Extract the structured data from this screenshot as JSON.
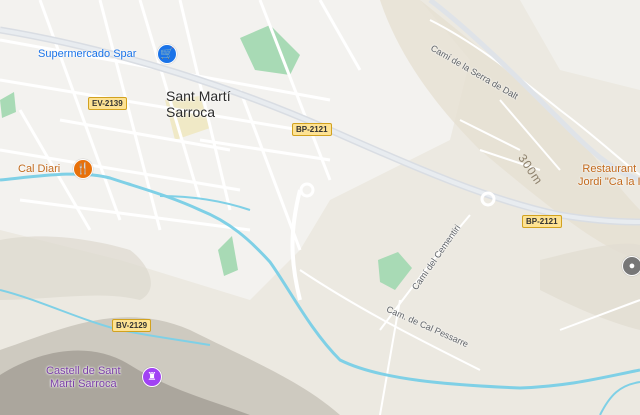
{
  "map": {
    "colors": {
      "land": "#ece9e1",
      "urban": "#f4f3f1",
      "street": "#ffffff",
      "main_road": "#dfe3e8",
      "park": "#a8dab5",
      "river": "#7fd0e6",
      "terrain": "#b8b2a6",
      "blue_poi": "#1a73e8",
      "orange_poi": "#e8710a",
      "purple_poi": "#a142f4",
      "road_shield": "#fde293"
    },
    "town": {
      "line1": "Sant Martí",
      "line2": "Sarroca"
    },
    "pois": {
      "supermarket": {
        "name": "Supermercado Spar",
        "icon": "shopping-cart-icon"
      },
      "restaurant_diari": {
        "name": "Cal Diari",
        "icon": "fork-knife-icon"
      },
      "castle": {
        "line1": "Castell de Sant",
        "line2": "Martí Sarroca",
        "icon": "castle-icon"
      },
      "restaurant_right": {
        "line1": "Restaurant",
        "line2": "Jordi \"Ca la I",
        "icon": "restaurant-icon"
      },
      "place_marker": {
        "icon": "place-pin-icon"
      }
    },
    "road_shields": {
      "ev2139": "EV-2139",
      "bp2121_a": "BP-2121",
      "bp2121_b": "BP-2121",
      "bv2129": "BV-2129"
    },
    "streets": {
      "serra_de_dalt": "Camí de la Serra de Dalt",
      "cementiri": "Camí del Cementiri",
      "cal_pessarre": "Cam. de Cal Pessarre"
    },
    "contour": "300m"
  }
}
